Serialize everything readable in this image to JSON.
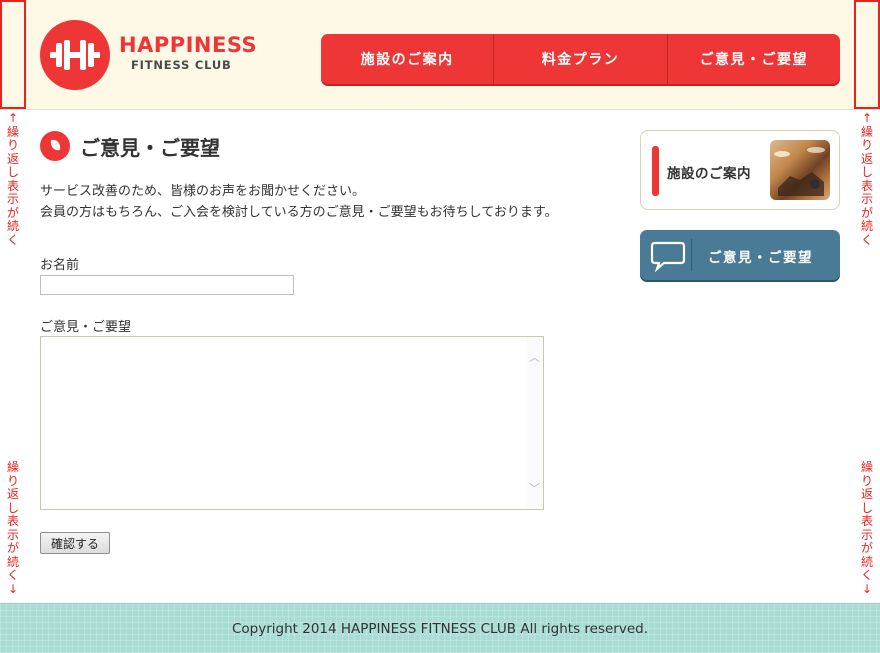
{
  "header": {
    "logo_title": "HAPPINESS",
    "logo_subtitle": "FITNESS CLUB",
    "nav": [
      {
        "label": "施設のご案内"
      },
      {
        "label": "料金プラン"
      },
      {
        "label": "ご意見・ご要望"
      }
    ]
  },
  "side_note": "繰り返し表示が続く",
  "main": {
    "title": "ご意見・ご要望",
    "intro_line1": "サービス改善のため、皆様のお声をお聞かせください。",
    "intro_line2": "会員の方はもちろん、ご入会を検討している方のご意見・ご要望もお待ちしております。",
    "form": {
      "name_label": "お名前",
      "name_value": "",
      "message_label": "ご意見・ご要望",
      "message_value": "",
      "submit_label": "確認する"
    }
  },
  "sidebar": {
    "facility_banner_label": "施設のご案内",
    "opinion_banner_label": "ご意見・ご要望"
  },
  "footer": {
    "copyright": "Copyright 2014 HAPPINESS FITNESS CLUB All rights reserved."
  },
  "colors": {
    "brand_red": "#ef3636",
    "header_bg": "#fdf9e6",
    "opinion_blue": "#4a7b96",
    "footer_teal": "#a9dcd4",
    "annotation_red": "#e8231f"
  }
}
